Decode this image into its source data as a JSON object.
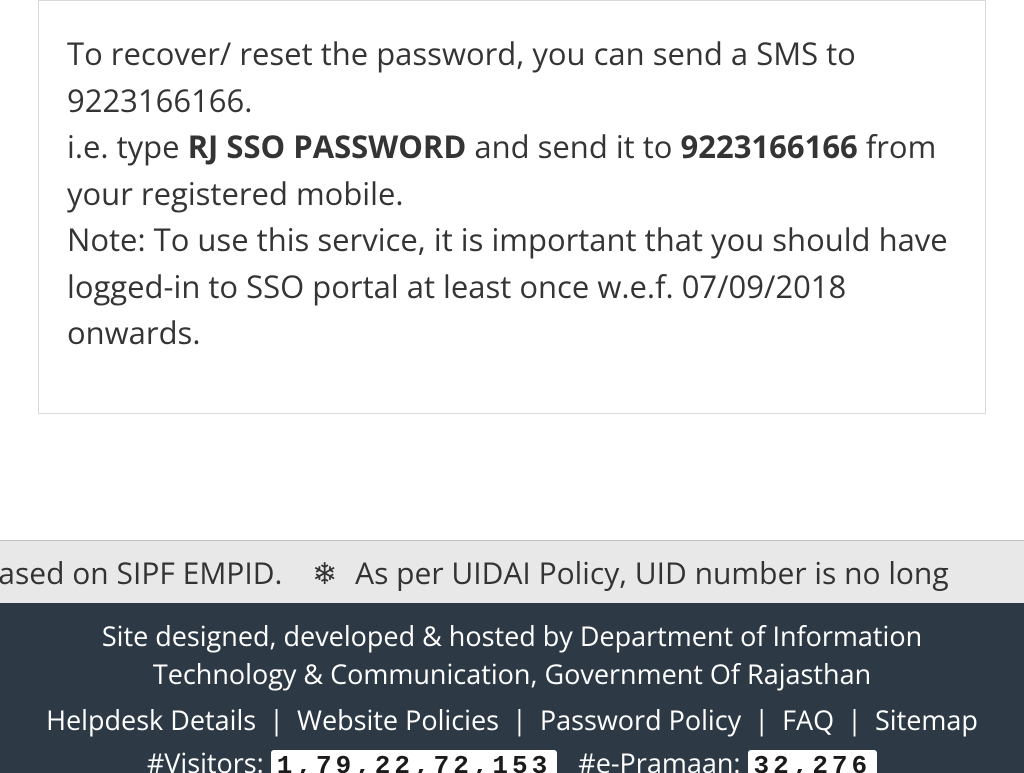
{
  "info": {
    "line1_a": "To recover/ reset the password, you can send a SMS to 9223166166.",
    "line2_a": "i.e. type ",
    "line2_bold1": "RJ SSO PASSWORD",
    "line2_b": " and send it to ",
    "line2_bold2": "9223166166",
    "line2_c": " from your registered mobile.",
    "line3": "Note: To use this service, it is important that you should have logged-in to SSO portal at least once w.e.f. 07/09/2018 onwards."
  },
  "ticker": {
    "frag1": "ID based on SIPF EMPID.",
    "frag2": "As per UIDAI Policy, UID number is no long"
  },
  "footer": {
    "credit": "Site designed, developed & hosted by Department of Information Technology & Communication, Government Of Rajasthan",
    "links": {
      "helpdesk": "Helpdesk Details",
      "policies": "Website Policies",
      "password": "Password Policy",
      "faq": "FAQ",
      "sitemap": "Sitemap"
    },
    "visitors_label": "#Visitors:",
    "visitors_value": "1,79,22,72,153",
    "epramaan_label": "#e-Pramaan:",
    "epramaan_value": "32,276"
  }
}
